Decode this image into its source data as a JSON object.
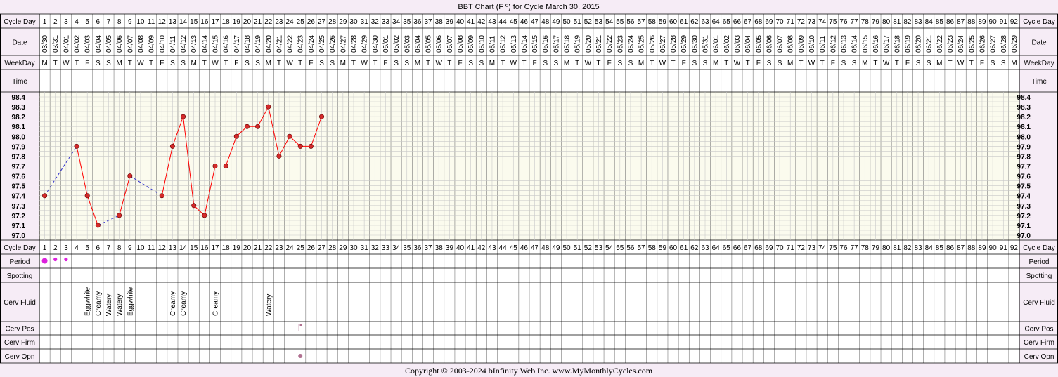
{
  "title": "BBT Chart (F º) for Cycle March 30, 2015",
  "footer": "Copyright © 2003-2024 bInfinity Web Inc.     www.MyMonthlyCycles.com",
  "row_labels": {
    "cycle_day": "Cycle Day",
    "date": "Date",
    "weekday": "WeekDay",
    "time": "Time",
    "period": "Period",
    "spotting": "Spotting",
    "cerv_fluid": "Cerv Fluid",
    "cerv_pos": "Cerv Pos",
    "cerv_firm": "Cerv Firm",
    "cerv_opn": "Cerv Opn"
  },
  "colors": {
    "background": "#f6ecf6",
    "plot_bg": "#fbfbee",
    "grid": "#c8c8c8",
    "line": "#ff0000",
    "dot": "#d42a2a",
    "dashed": "#3333cc",
    "period_dot": "#dd22dd",
    "cerv_mark": "#b07090"
  },
  "chart_data": {
    "type": "line",
    "title": "BBT Chart (F º) for Cycle March 30, 2015",
    "x": [
      1,
      2,
      3,
      4,
      5,
      6,
      7,
      8,
      9,
      10,
      11,
      12,
      13,
      14,
      15,
      16,
      17,
      18,
      19,
      20,
      21,
      22,
      23,
      24,
      25,
      26,
      27,
      28,
      29,
      30,
      31,
      32,
      33,
      34,
      35,
      36,
      37,
      38,
      39,
      40,
      41,
      42,
      43,
      44,
      45,
      46,
      47,
      48,
      49,
      50,
      51,
      52,
      53,
      54,
      55,
      56,
      57,
      58,
      59,
      60,
      61,
      62,
      63,
      64,
      65,
      66,
      67,
      68,
      69,
      70,
      71,
      72,
      73,
      74,
      75,
      76,
      77,
      78,
      79,
      80,
      81,
      82,
      83,
      84,
      85,
      86,
      87,
      88,
      89,
      90,
      91,
      92
    ],
    "dates": [
      "03/30",
      "03/31",
      "04/01",
      "04/02",
      "04/03",
      "04/04",
      "04/05",
      "04/06",
      "04/07",
      "04/08",
      "04/09",
      "04/10",
      "04/11",
      "04/12",
      "04/13",
      "04/14",
      "04/15",
      "04/16",
      "04/17",
      "04/18",
      "04/19",
      "04/20",
      "04/21",
      "04/22",
      "04/23",
      "04/24",
      "04/25",
      "04/26",
      "04/27",
      "04/28",
      "04/29",
      "04/30",
      "05/01",
      "05/02",
      "05/03",
      "05/04",
      "05/05",
      "05/06",
      "05/07",
      "05/08",
      "05/09",
      "05/10",
      "05/11",
      "05/12",
      "05/13",
      "05/14",
      "05/15",
      "05/16",
      "05/17",
      "05/18",
      "05/19",
      "05/20",
      "05/21",
      "05/22",
      "05/23",
      "05/24",
      "05/25",
      "05/26",
      "05/27",
      "05/28",
      "05/29",
      "05/30",
      "05/31",
      "06/01",
      "06/02",
      "06/03",
      "06/04",
      "06/05",
      "06/06",
      "06/07",
      "06/08",
      "06/09",
      "06/10",
      "06/11",
      "06/12",
      "06/13",
      "06/14",
      "06/15",
      "06/16",
      "06/17",
      "06/18",
      "06/19",
      "06/20",
      "06/21",
      "06/22",
      "06/23",
      "06/24",
      "06/25",
      "06/26",
      "06/27",
      "06/28",
      "06/29"
    ],
    "weekdays": [
      "M",
      "T",
      "W",
      "T",
      "F",
      "S",
      "S",
      "M",
      "T",
      "W",
      "T",
      "F",
      "S",
      "S",
      "M",
      "T",
      "W",
      "T",
      "F",
      "S",
      "S",
      "M",
      "T",
      "W",
      "T",
      "F",
      "S",
      "S",
      "M",
      "T",
      "W",
      "T",
      "F",
      "S",
      "S",
      "M",
      "T",
      "W",
      "T",
      "F",
      "S",
      "S",
      "M",
      "T",
      "W",
      "T",
      "F",
      "S",
      "S",
      "M",
      "T",
      "W",
      "T",
      "F",
      "S",
      "S",
      "M",
      "T",
      "W",
      "T",
      "F",
      "S",
      "S",
      "M",
      "T",
      "W",
      "T",
      "F",
      "S",
      "S",
      "M",
      "T",
      "W",
      "T",
      "F",
      "S",
      "S",
      "M",
      "T",
      "W",
      "T",
      "F",
      "S",
      "S",
      "M",
      "T",
      "W",
      "T",
      "F",
      "S",
      "S",
      "M"
    ],
    "temps": [
      97.4,
      null,
      null,
      97.9,
      97.4,
      97.1,
      null,
      97.2,
      97.6,
      null,
      null,
      97.4,
      97.9,
      98.2,
      97.3,
      97.2,
      97.7,
      97.7,
      98.0,
      98.1,
      98.1,
      98.3,
      97.8,
      98.0,
      97.9,
      97.9,
      98.2
    ],
    "ylim": [
      97.0,
      98.4
    ],
    "yticks": [
      "98.4",
      "98.3",
      "98.2",
      "98.1",
      "98.0",
      "97.9",
      "97.8",
      "97.7",
      "97.6",
      "97.5",
      "97.4",
      "97.3",
      "97.2",
      "97.1",
      "97.0"
    ],
    "period": [
      {
        "day": 1,
        "size": "heavy"
      },
      {
        "day": 2,
        "size": "light"
      },
      {
        "day": 3,
        "size": "light"
      }
    ],
    "cerv_fluid": [
      {
        "day": 5,
        "label": "Eggwhite"
      },
      {
        "day": 6,
        "label": "Creamy"
      },
      {
        "day": 7,
        "label": "Watery"
      },
      {
        "day": 8,
        "label": "Watery"
      },
      {
        "day": 9,
        "label": "Eggwhite"
      },
      {
        "day": 13,
        "label": "Creamy"
      },
      {
        "day": 14,
        "label": "Creamy"
      },
      {
        "day": 17,
        "label": "Creamy"
      },
      {
        "day": 22,
        "label": "Watery"
      }
    ],
    "cerv_pos": [
      {
        "day": 25
      }
    ],
    "cerv_opn": [
      {
        "day": 25
      }
    ],
    "grid": true
  }
}
